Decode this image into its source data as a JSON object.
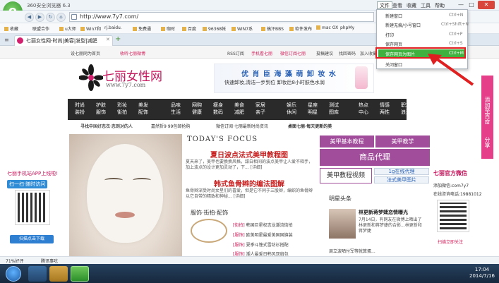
{
  "window": {
    "title": "360安全浏览器 6.3",
    "menus": [
      "文件",
      "查看",
      "收藏",
      "工具",
      "帮助"
    ]
  },
  "address": {
    "url": "http://www.7y7.com/"
  },
  "favorites": [
    "收藏",
    "联盟合作",
    "u大师",
    "Win7和",
    "rj.baidu.",
    "免费通",
    "咖时",
    "百度",
    "96368帐",
    "WIN7系",
    "搞汗BBS",
    "软件发布",
    "mac OX",
    "phpMy"
  ],
  "tab": {
    "title": "七丽女性网-时尚|美容|发型|减肥"
  },
  "menu": {
    "items": [
      {
        "label": "新建窗口",
        "shortcut": "Ctrl+N"
      },
      {
        "label": "新建无痕/小号窗口",
        "shortcut": "Ctrl+Shift+N"
      },
      {
        "label": "打印",
        "shortcut": "Ctrl+P"
      },
      {
        "label": "保存网页",
        "shortcut": "Ctrl+S"
      },
      {
        "label": "保存网页为图片",
        "shortcut": "Ctrl+M"
      },
      {
        "label": "关闭窗口",
        "shortcut": ""
      }
    ]
  },
  "site": {
    "topbar": [
      "设七丽网为首页",
      "收听七丽微博",
      "RSS订阅",
      "手机看七丽",
      "微信订阅七丽",
      "投稿建议",
      "找回密码",
      "加入收藏"
    ],
    "logo": {
      "text": "七丽女性网",
      "url": "www.7y7.com"
    },
    "banner": {
      "title": "优 肖 臣 海 藻 萌 卸 妆 水",
      "sub": "快速卸妆,清洁一步到位 卸妆后8小时肤色水润"
    },
    "nav": [
      [
        "时尚",
        "装扮"
      ],
      [
        "护肤",
        "服饰"
      ],
      [
        "彩妆",
        "街拍"
      ],
      [
        "美发",
        "配饰"
      ],
      [
        "品味",
        "生活"
      ],
      [
        "网购",
        "健康"
      ],
      [
        "瘦身",
        "数码"
      ],
      [
        "美食",
        "减肥"
      ],
      [
        "家居",
        "亲子"
      ],
      [
        "娱乐",
        "休闲"
      ],
      [
        "星座",
        "明星"
      ],
      [
        "测试",
        "图库"
      ],
      [
        "热点",
        "中心"
      ],
      [
        "情感",
        "两性"
      ],
      [
        "职场",
        "浪漫"
      ]
    ],
    "subnav": [
      "寻找中国好恋衣·恋到对的人",
      "嘉然折9·99包邮抢购",
      "微信订阅·七丽最新时尚资讯",
      "桌面七丽·每天更新的美"
    ],
    "focus": "TODAY'S FOCUS",
    "headline1": "夏日波点法式美甲教程图",
    "headline1_body": "夏天来了，美甲也要换换风格，甜白相间的波点美甲让人爱不释手，加上波点的设计更加灵动了，下... [详细]",
    "headline2": "韩式鱼骨辫的编法图解",
    "headline2_body": "鱼骨辫深受时尚女星们的喜爱，但是它不同于三股辫，编织的鱼骨辫以它自带的精致和神秘... [详细]",
    "fashion_title": "服饰·街拍·配饰",
    "fashion_lines": [
      {
        "tag": "[街拍]",
        "text": "韩国巨星权志龙潮流街拍"
      },
      {
        "tag": "[服饰]",
        "text": "欧美明星最爱美国国旗装"
      },
      {
        "tag": "[服饰]",
        "text": "夏季斗篷式雪纺衫搭配"
      },
      {
        "tag": "[服饰]",
        "text": "潮人最爱日韩风双肩包"
      }
    ],
    "right_links": [
      "美甲基本教程",
      "美甲教学",
      "商品代理",
      "美甲教程视频",
      "1g在线代理",
      "法式美甲图片"
    ],
    "news_title": "明星头条",
    "news_head": "林更新蒋梦婕恋情曝光",
    "news_body": "7月14日，有网友在微博上晒出了林更新和蒋梦婕的合影...林更新和蒋梦婕",
    "news_line": "周立波晒付军等就算蛋...",
    "left_promo": {
      "title": "七丽手机站APP上线啦!",
      "qr_label": "扫一扫·随时访问",
      "btn": "扫描点击下载"
    },
    "official": {
      "title": "七丽官方微信",
      "wechat": "添加微信:com7y7",
      "phone": "在线咨询电话:19881012",
      "label": "扫描立即关注"
    },
    "side_ad": "添加至百度新首页",
    "side_share": "分享"
  },
  "statusbar": {
    "zoom": "71%好评",
    "notice": "腾讯事吃"
  },
  "clock": {
    "time": "17:04",
    "date": "2014/7/16"
  }
}
